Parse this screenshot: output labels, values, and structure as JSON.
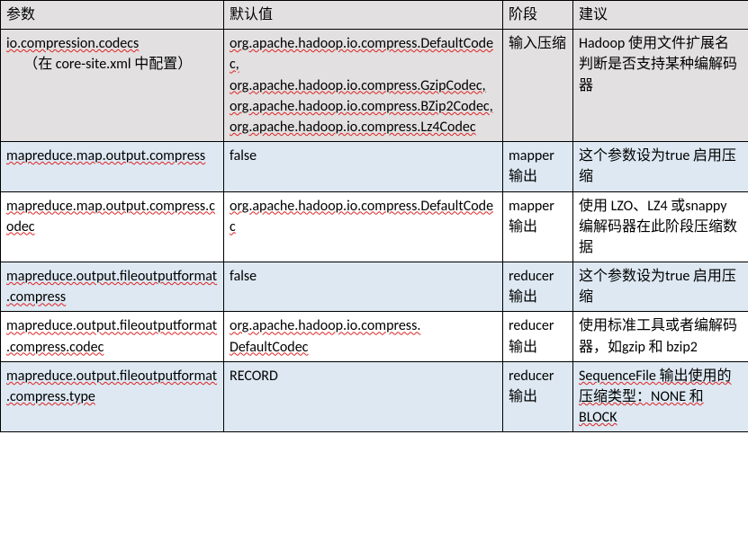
{
  "headers": {
    "param": "参数",
    "default": "默认值",
    "stage": "阶段",
    "advice": "建议"
  },
  "chart_data": {
    "type": "table",
    "columns": [
      "参数",
      "默认值",
      "阶段",
      "建议"
    ],
    "rows": [
      {
        "param": "io.compression.codecs",
        "param_note": "（在 core-site.xml 中配置）",
        "default_lines": [
          "org.apache.hadoop.io.compress.DefaultCodec,",
          "org.apache.hadoop.io.compress.GzipCodec,",
          "org.apache.hadoop.io.compress.BZip2Codec,",
          "org.apache.hadoop.io.compress.Lz4Codec"
        ],
        "stage": "输入压缩",
        "advice": "Hadoop 使用文件扩展名判断是否支持某种编解码器"
      },
      {
        "param": "mapreduce.map.output.compress",
        "default_lines": [
          "false"
        ],
        "stage": "mapper输出",
        "advice": "这个参数设为true 启用压缩"
      },
      {
        "param": "mapreduce.map.output.compress.codec",
        "default_lines": [
          "org.apache.hadoop.io.compress.DefaultCodec"
        ],
        "stage": "mapper输出",
        "advice": "使用 LZO、LZ4 或snappy 编解码器在此阶段压缩数据"
      },
      {
        "param": "mapreduce.output.fileoutputformat.compress",
        "default_lines": [
          "false"
        ],
        "stage": "reducer输出",
        "advice": "这个参数设为true 启用压缩"
      },
      {
        "param": "mapreduce.output.fileoutputformat.compress.codec",
        "default_lines": [
          "org.apache.hadoop.io.compress. DefaultCodec"
        ],
        "stage": "reducer输出",
        "advice": "使用标准工具或者编解码器，如gzip 和 bzip2"
      },
      {
        "param": "mapreduce.output.fileoutputformat.compress.type",
        "default_lines": [
          "RECORD"
        ],
        "stage": "reducer输出",
        "advice": "SequenceFile 输出使用的压缩类型：NONE 和 BLOCK"
      }
    ]
  }
}
